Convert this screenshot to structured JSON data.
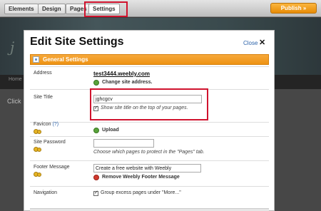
{
  "toolbar": {
    "tabs": [
      {
        "label": "Elements"
      },
      {
        "label": "Design"
      },
      {
        "label": "Pages"
      },
      {
        "label": "Settings",
        "active": true
      }
    ],
    "publish_label": "Publish »"
  },
  "background_site": {
    "title": "j",
    "nav_item": "Home",
    "body_text": "Click"
  },
  "dialog": {
    "title": "Edit Site Settings",
    "close_label": "Close",
    "close_glyph": "✕",
    "section_title": "General Settings",
    "address": {
      "label": "Address",
      "value": "test3444.weebly.com",
      "change_link": "Change site address."
    },
    "site_title": {
      "label": "Site Title",
      "value": "jghcgcv",
      "show_title_checked": true,
      "show_title_label": "Show site title on the top of your pages."
    },
    "favicon": {
      "label": "Favicon",
      "help": "(?)",
      "upload_label": "Upload"
    },
    "site_password": {
      "label": "Site Password",
      "value": "",
      "note": "Choose which pages to protect in the \"Pages\" tab."
    },
    "footer_message": {
      "label": "Footer Message",
      "value": "Create a free website with Weebly",
      "remove_link": "Remove Weebly Footer Message"
    },
    "navigation": {
      "label": "Navigation",
      "group_checked": true,
      "group_label": "Group excess pages under \"More...\""
    }
  },
  "colors": {
    "accent_orange": "#ee9313",
    "highlight_red": "#d0132e",
    "link_blue": "#2b62a9"
  }
}
